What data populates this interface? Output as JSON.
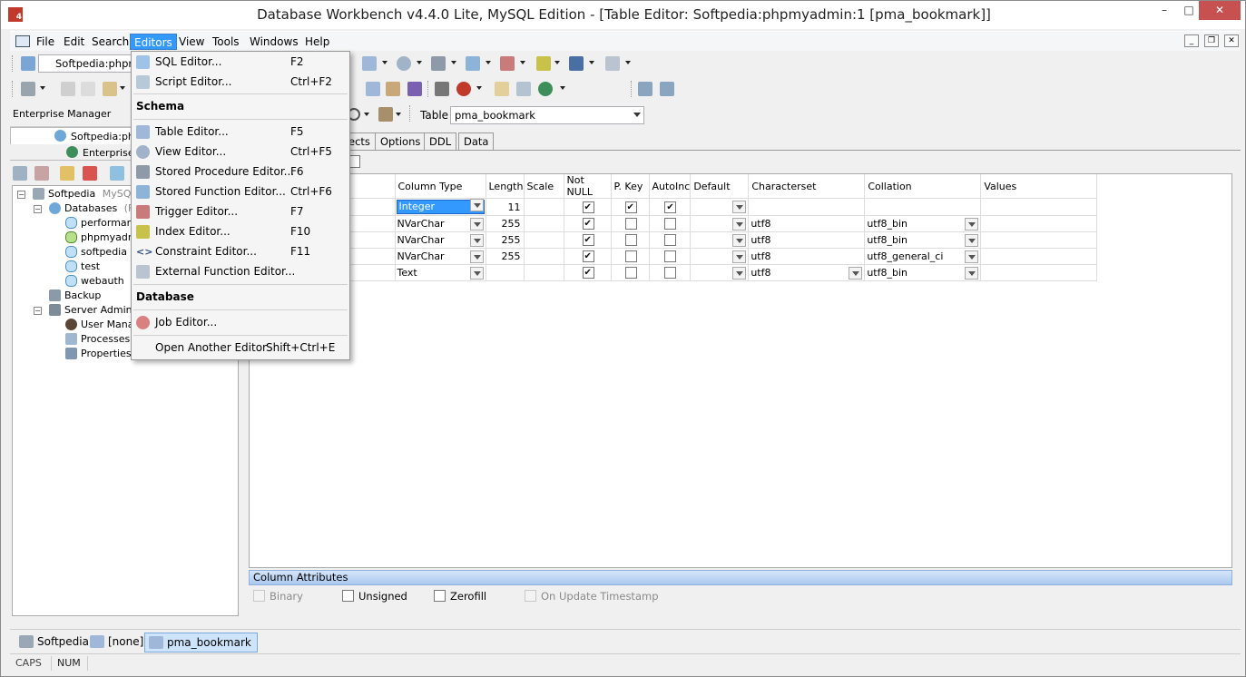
{
  "window": {
    "title": "Database Workbench v4.4.0 Lite, MySQL Edition - [Table Editor: Softpedia:phpmyadmin:1 [pma_bookmark]]",
    "app_icon_text": "4"
  },
  "menubar": {
    "items": [
      "File",
      "Edit",
      "Search",
      "Editors",
      "View",
      "Tools",
      "Windows",
      "Help"
    ]
  },
  "toolbar": {
    "connection_value": "Softpedia:phpm",
    "table_label": "Table",
    "table_value": "pma_bookmark"
  },
  "left_panel": {
    "title": "Enterprise Manager",
    "tab_server": "Softpedia:php",
    "tab_enterprise": "Enterprise",
    "tree": {
      "server": "Softpedia",
      "server_type": "MySQL",
      "databases": "Databases",
      "databases_suffix": "(Fi",
      "db_items": [
        "performanc",
        "phpmyadmi",
        "softpedia",
        "test",
        "webauth"
      ],
      "backup": "Backup",
      "server_admin": "Server Adminis",
      "admin_items": [
        "User Manag",
        "Processes",
        "Properties"
      ]
    }
  },
  "editor": {
    "tabs": [
      "ects",
      "Options",
      "DDL",
      "Data"
    ],
    "columns": [
      "Column Type",
      "Length",
      "Scale",
      "Not NULL",
      "P. Key",
      "AutoInc",
      "Default",
      "Characterset",
      "Collation",
      "Values"
    ],
    "rows": [
      {
        "type": "Integer",
        "length": "11",
        "scale": "",
        "not_null": true,
        "pkey": true,
        "autoinc": true,
        "charset": "",
        "collation": ""
      },
      {
        "type": "NVarChar",
        "length": "255",
        "scale": "",
        "not_null": true,
        "pkey": false,
        "autoinc": false,
        "charset": "utf8",
        "collation": "utf8_bin"
      },
      {
        "type": "NVarChar",
        "length": "255",
        "scale": "",
        "not_null": true,
        "pkey": false,
        "autoinc": false,
        "charset": "utf8",
        "collation": "utf8_bin"
      },
      {
        "type": "NVarChar",
        "length": "255",
        "scale": "",
        "not_null": true,
        "pkey": false,
        "autoinc": false,
        "charset": "utf8",
        "collation": "utf8_general_ci"
      },
      {
        "type": "Text",
        "length": "",
        "scale": "",
        "not_null": true,
        "pkey": false,
        "autoinc": false,
        "charset": "utf8",
        "collation": "utf8_bin"
      }
    ],
    "column_attributes": {
      "title": "Column Attributes",
      "binary": "Binary",
      "unsigned": "Unsigned",
      "zerofill": "Zerofill",
      "on_update": "On Update Timestamp"
    }
  },
  "editors_menu": {
    "sql_editor": {
      "label": "SQL Editor...",
      "shortcut": "F2"
    },
    "script_editor": {
      "label": "Script Editor...",
      "shortcut": "Ctrl+F2"
    },
    "schema_header": "Schema",
    "table_editor": {
      "label": "Table Editor...",
      "shortcut": "F5"
    },
    "view_editor": {
      "label": "View Editor...",
      "shortcut": "Ctrl+F5"
    },
    "stored_proc_editor": {
      "label": "Stored Procedure Editor...",
      "shortcut": "F6"
    },
    "stored_func_editor": {
      "label": "Stored Function Editor...",
      "shortcut": "Ctrl+F6"
    },
    "trigger_editor": {
      "label": "Trigger Editor...",
      "shortcut": "F7"
    },
    "index_editor": {
      "label": "Index Editor...",
      "shortcut": "F10"
    },
    "constraint_editor": {
      "label": "Constraint Editor...",
      "shortcut": "F11"
    },
    "external_func_editor": {
      "label": "External Function Editor...",
      "shortcut": ""
    },
    "database_header": "Database",
    "job_editor": {
      "label": "Job Editor...",
      "shortcut": ""
    },
    "open_another": {
      "label": "Open Another Editor",
      "shortcut": "Shift+Ctrl+E"
    }
  },
  "taskbar": {
    "items": [
      "Softpedia",
      "[none]",
      "pma_bookmark"
    ]
  },
  "statusbar": {
    "caps": "CAPS",
    "num": "NUM"
  },
  "colors": {
    "accent": "#3399ff",
    "close": "#c75050",
    "header_gradient": "#a9c8ef"
  }
}
